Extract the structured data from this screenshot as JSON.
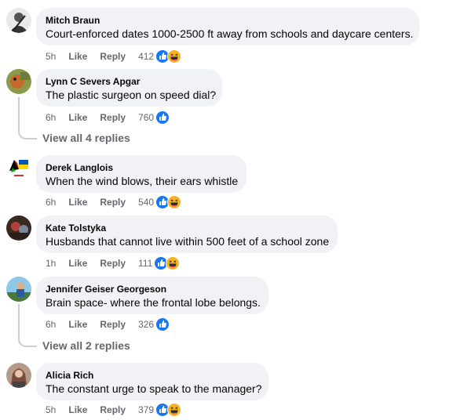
{
  "comments": [
    {
      "author": "Mitch Braun",
      "text": "Court-enforced dates 1000-2500 ft away from schools and daycare centers.",
      "time": "5h",
      "like": "Like",
      "reply": "Reply",
      "count": "412",
      "reactions": [
        "like-icon",
        "haha-icon"
      ]
    },
    {
      "author": "Lynn C Severs Apgar",
      "text": "The plastic surgeon on speed dial?",
      "time": "6h",
      "like": "Like",
      "reply": "Reply",
      "count": "760",
      "reactions": [
        "like-icon"
      ],
      "view_replies": "View all 4 replies"
    },
    {
      "author": "Derek Langlois",
      "text": "When the wind blows, their ears whistle",
      "time": "6h",
      "like": "Like",
      "reply": "Reply",
      "count": "540",
      "reactions": [
        "like-icon",
        "haha-icon"
      ]
    },
    {
      "author": "Kate Tolstyka",
      "text": "Husbands that cannot live within 500 feet of a school zone",
      "time": "1h",
      "like": "Like",
      "reply": "Reply",
      "count": "111",
      "reactions": [
        "like-icon",
        "haha-icon"
      ]
    },
    {
      "author": "Jennifer Geiser Georgeson",
      "text": "Brain space- where the frontal lobe belongs.",
      "time": "6h",
      "like": "Like",
      "reply": "Reply",
      "count": "326",
      "reactions": [
        "like-icon"
      ],
      "view_replies": "View all 2 replies"
    },
    {
      "author": "Alicia Rich",
      "text": "The constant urge to speak to the manager?",
      "time": "5h",
      "like": "Like",
      "reply": "Reply",
      "count": "379",
      "reactions": [
        "like-icon",
        "haha-icon"
      ]
    }
  ],
  "colors": {
    "bubble": "#f0f2f5",
    "meta": "#65676b",
    "like_blue": "#1877f2",
    "haha_yellow": "#f7b125"
  }
}
